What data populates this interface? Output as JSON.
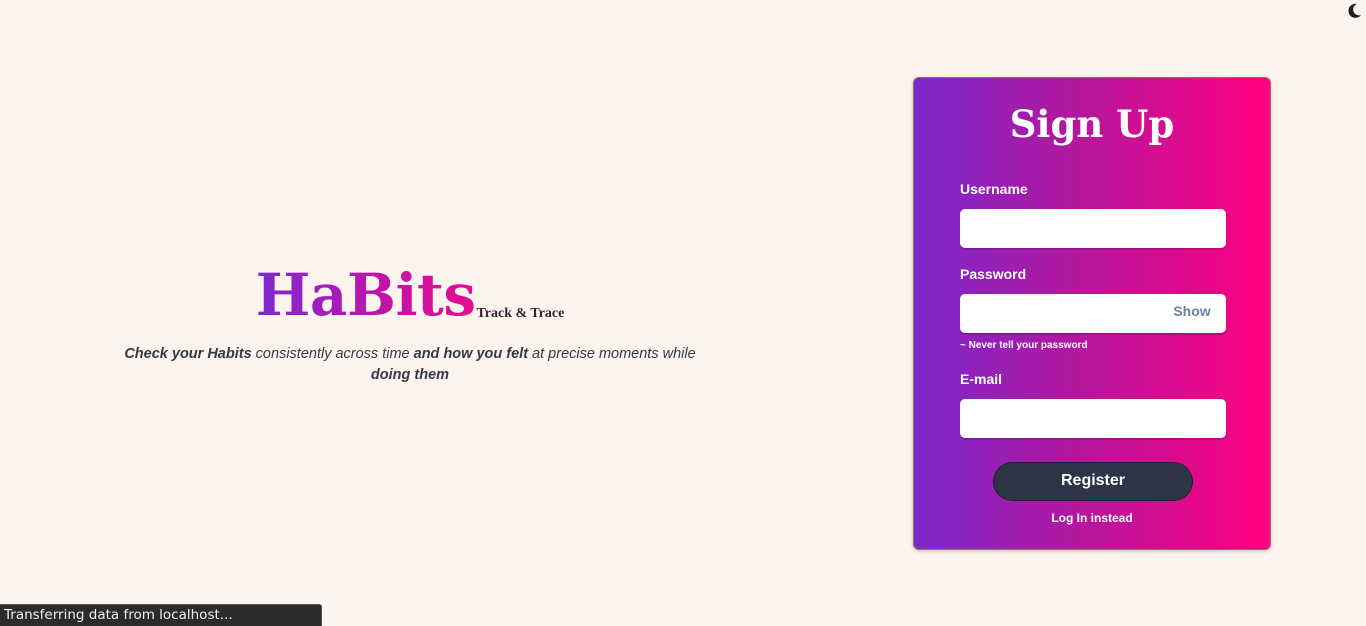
{
  "theme_toggle": {
    "icon": "moon-icon"
  },
  "hero": {
    "brand": "HaBits",
    "subtitle": "Track & Trace",
    "tagline": {
      "part1": "Check your Habits",
      "part2": " consistently across time ",
      "part3": "and how you felt",
      "part4": " at precise moments while ",
      "part5": "doing them"
    }
  },
  "signup": {
    "title": "Sign Up",
    "username_label": "Username",
    "username_value": "",
    "password_label": "Password",
    "password_value": "",
    "show_label": "Show",
    "password_hint": "~ Never tell your password",
    "email_label": "E-mail",
    "email_value": "",
    "register_label": "Register",
    "login_link": "Log In instead"
  },
  "status_bar": {
    "text": "Transferring data from localhost..."
  },
  "colors": {
    "background": "#fdf4ee",
    "gradient_start": "#7b28cc",
    "gradient_end": "#ff0080",
    "button": "#2d3446"
  }
}
